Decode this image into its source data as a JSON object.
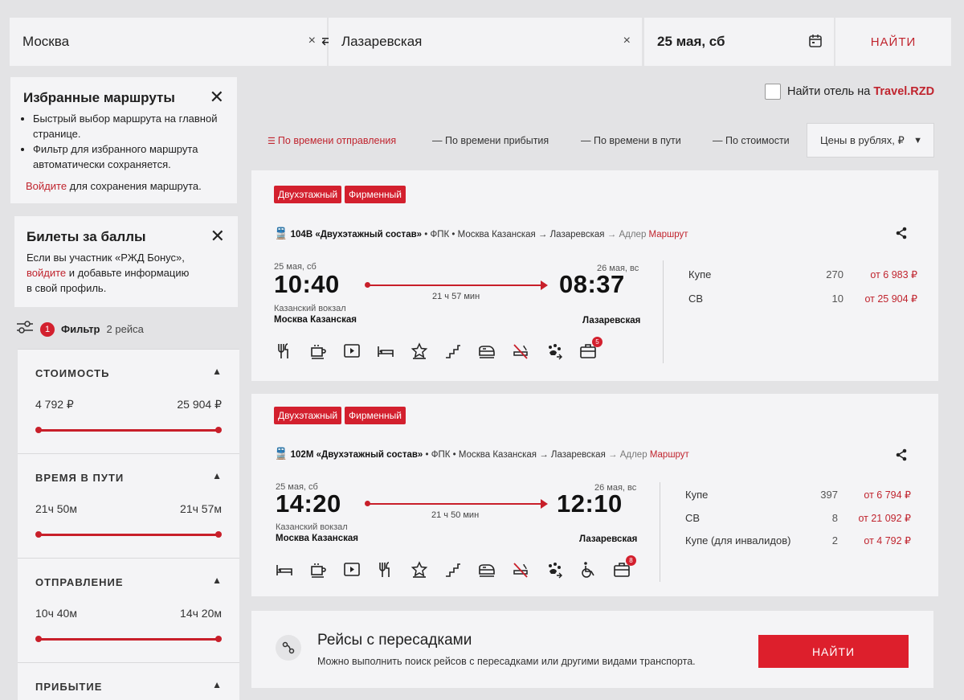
{
  "search": {
    "from": "Москва",
    "to": "Лазаревская",
    "date": "25 мая, сб",
    "find_label": "НАЙТИ",
    "clear_symbol": "×"
  },
  "favorites": {
    "title": "Избранные маршруты",
    "bullets": [
      "Быстрый выбор маршрута на главной странице.",
      "Фильтр для избранного маршрута автоматически сохраняется."
    ],
    "login_link": "Войдите",
    "login_rest": " для сохранения маршрута."
  },
  "points": {
    "title": "Билеты за баллы",
    "text1": "Если вы участник «РЖД Бонус»,",
    "login_link": "войдите",
    "text2": " и добавьте информацию",
    "text3": "в свой профиль."
  },
  "filter": {
    "count": "1",
    "label": "Фильтр",
    "trips": "2 рейса",
    "sections": [
      {
        "title": "СТОИМОСТЬ",
        "min": "4 792 ₽",
        "max": "25 904 ₽"
      },
      {
        "title": "ВРЕМЯ В ПУТИ",
        "min": "21ч 50м",
        "max": "21ч 57м"
      },
      {
        "title": "ОТПРАВЛЕНИЕ",
        "min": "10ч 40м",
        "max": "14ч 20м"
      },
      {
        "title": "ПРИБЫТИЕ"
      }
    ]
  },
  "hotel": {
    "text": "Найти отель на ",
    "brand": "Travel.RZD"
  },
  "sorting": {
    "options": [
      "По времени отправления",
      "По времени прибытия",
      "По времени в пути",
      "По стоимости"
    ],
    "currency": "Цены в рублях, ₽"
  },
  "trains": [
    {
      "badges": [
        "Двухэтажный",
        "Фирменный"
      ],
      "number": "104В «Двухэтажный состав»",
      "carrier": "ФПК",
      "route_from": "Москва Казанская",
      "route_to": "Лазаревская",
      "route_end": "Адлер",
      "route_link": "Маршрут",
      "dep_date": "25 мая, сб",
      "dep_time": "10:40",
      "arr_date": "26 мая, вс",
      "arr_time": "08:37",
      "duration": "21 ч 57 мин",
      "dep_station": "Казанский вокзал",
      "dep_city": "Москва Казанская",
      "arr_city": "Лазаревская",
      "classes": [
        {
          "name": "Купе",
          "seats": "270",
          "price": "от 6 983 ₽"
        },
        {
          "name": "СВ",
          "seats": "10",
          "price": "от 25 904 ₽"
        }
      ],
      "amenities": [
        "restaurant-icon",
        "coffee-icon",
        "video-icon",
        "bed-icon",
        "star-icon",
        "stairs-icon",
        "train-icon",
        "no-smoking-icon",
        "pets-icon",
        "luggage-icon"
      ],
      "luggage_count": "5"
    },
    {
      "badges": [
        "Двухэтажный",
        "Фирменный"
      ],
      "number": "102М «Двухэтажный состав»",
      "carrier": "ФПК",
      "route_from": "Москва Казанская",
      "route_to": "Лазаревская",
      "route_end": "Адлер",
      "route_link": "Маршрут",
      "dep_date": "25 мая, сб",
      "dep_time": "14:20",
      "arr_date": "26 мая, вс",
      "arr_time": "12:10",
      "duration": "21 ч 50 мин",
      "dep_station": "Казанский вокзал",
      "dep_city": "Москва Казанская",
      "arr_city": "Лазаревская",
      "classes": [
        {
          "name": "Купе",
          "seats": "397",
          "price": "от 6 794 ₽"
        },
        {
          "name": "СВ",
          "seats": "8",
          "price": "от 21 092 ₽"
        },
        {
          "name": "Купе (для инвалидов)",
          "seats": "2",
          "price": "от 4 792 ₽"
        }
      ],
      "amenities": [
        "bed-icon",
        "coffee-icon",
        "video-icon",
        "restaurant-icon",
        "star-icon",
        "stairs-icon",
        "train-icon",
        "no-smoking-icon",
        "pets-icon",
        "wheelchair-icon",
        "luggage-icon"
      ],
      "luggage_count": "8"
    }
  ],
  "transfers": {
    "title": "Рейсы с пересадками",
    "text": "Можно выполнить поиск рейсов с пересадками или другими видами транспорта.",
    "find_label": "НАЙТИ"
  }
}
